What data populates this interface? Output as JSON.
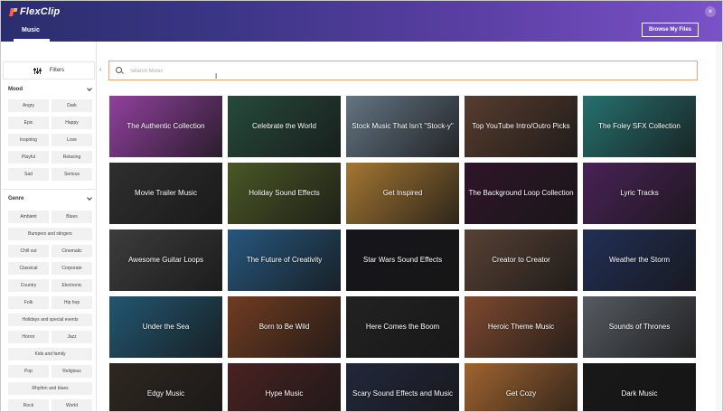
{
  "app": {
    "logo": "FlexClip"
  },
  "header": {
    "tab_label": "Music",
    "browse_label": "Browse My Files",
    "close_symbol": "×"
  },
  "sidebar": {
    "filters_label": "Filters",
    "mood_label": "Mood",
    "mood_items": [
      "Angry",
      "Dark",
      "Epic",
      "Happy",
      "Inspiring",
      "Love",
      "Playful",
      "Relaxing",
      "Sad",
      "Serious"
    ],
    "genre_label": "Genre",
    "genre_items": [
      "Ambient",
      "Blues",
      "Bumpers and stingers",
      "Chill out",
      "Cinematic",
      "Classical",
      "Corporate",
      "Country",
      "Electronic",
      "Folk",
      "Hip hop",
      "Holidays and special events",
      "Horror",
      "Jazz",
      "Kids and family",
      "Pop",
      "Religious",
      "Rhythm and blues",
      "Rock",
      "World"
    ]
  },
  "search": {
    "placeholder": "Search Music",
    "value": ""
  },
  "collapse_symbol": "‹",
  "collections": [
    {
      "title": "The Authentic Collection",
      "color": "#b24fc2"
    },
    {
      "title": "Celebrate the World",
      "color": "#2f5b4a"
    },
    {
      "title": "Stock Music That Isn't \"Stock-y\"",
      "color": "#7a8ea0"
    },
    {
      "title": "Top YouTube Intro/Outro Picks",
      "color": "#6b4a3a"
    },
    {
      "title": "The Foley SFX Collection",
      "color": "#2f8a88"
    },
    {
      "title": "Movie Trailer Music",
      "color": "#3a3a3a"
    },
    {
      "title": "Holiday Sound Effects",
      "color": "#5b6b2e"
    },
    {
      "title": "Get Inspired",
      "color": "#c9913e"
    },
    {
      "title": "The Background Loop Collection",
      "color": "#3a1a33"
    },
    {
      "title": "Lyric Tracks",
      "color": "#5a2a6a"
    },
    {
      "title": "Awesome Guitar Loops",
      "color": "#4a4a4a"
    },
    {
      "title": "The Future of Creativity",
      "color": "#2f6a9a"
    },
    {
      "title": "Star Wars Sound Effects",
      "color": "#1a1a22"
    },
    {
      "title": "Creator to Creator",
      "color": "#6b5040"
    },
    {
      "title": "Weather the Storm",
      "color": "#2a3a6a"
    },
    {
      "title": "Under the Sea",
      "color": "#2a6a8a"
    },
    {
      "title": "Born to Be Wild",
      "color": "#8a4a2a"
    },
    {
      "title": "Here Comes the Boom",
      "color": "#2a2a2a"
    },
    {
      "title": "Heroic Theme Music",
      "color": "#9a5a3a"
    },
    {
      "title": "Sounds of Thrones",
      "color": "#6a7078"
    },
    {
      "title": "Edgy Music",
      "color": "#3a3028"
    },
    {
      "title": "Hype Music",
      "color": "#5a2a2a"
    },
    {
      "title": "Scary Sound Effects and Music",
      "color": "#2a3048"
    },
    {
      "title": "Get Cozy",
      "color": "#c47a3a"
    },
    {
      "title": "Dark Music",
      "color": "#1e1e1e"
    }
  ]
}
